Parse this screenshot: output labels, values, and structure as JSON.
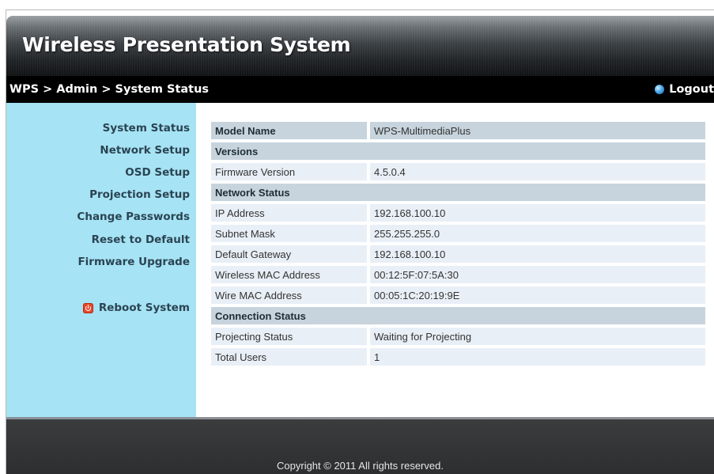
{
  "app": {
    "title": "Wireless Presentation System"
  },
  "breadcrumb": {
    "text": "WPS > Admin > System Status"
  },
  "header": {
    "logout_label": "Logout"
  },
  "sidebar": {
    "items": [
      {
        "label": "System Status"
      },
      {
        "label": "Network Setup"
      },
      {
        "label": "OSD Setup"
      },
      {
        "label": "Projection Setup"
      },
      {
        "label": "Change Passwords"
      },
      {
        "label": "Reset to Default"
      },
      {
        "label": "Firmware Upgrade"
      }
    ],
    "reboot_label": "Reboot System"
  },
  "status_table": {
    "model_name_label": "Model Name",
    "model_name_value": "WPS-MultimediaPlus",
    "versions_header": "Versions",
    "firmware_version_label": "Firmware Version",
    "firmware_version_value": "4.5.0.4",
    "network_status_header": "Network Status",
    "ip_address_label": "IP Address",
    "ip_address_value": "192.168.100.10",
    "subnet_mask_label": "Subnet Mask",
    "subnet_mask_value": "255.255.255.0",
    "default_gateway_label": "Default Gateway",
    "default_gateway_value": "192.168.100.10",
    "wireless_mac_label": "Wireless MAC Address",
    "wireless_mac_value": "00:12:5F:07:5A:30",
    "wire_mac_label": "Wire MAC Address",
    "wire_mac_value": "00:05:1C:20:19:9E",
    "connection_status_header": "Connection Status",
    "projecting_status_label": "Projecting Status",
    "projecting_status_value": "Waiting for Projecting",
    "total_users_label": "Total Users",
    "total_users_value": "1"
  },
  "footer": {
    "copyright": "Copyright © 2011 All rights reserved."
  },
  "colors": {
    "sidebar_bg": "#a6e3f5",
    "section_row_bg": "#c7d4dd",
    "data_row_bg": "#e9eff6",
    "reboot_icon": "#e8472b"
  },
  "icons": {
    "logout": "logout-bullet-icon",
    "reboot": "power-icon"
  }
}
